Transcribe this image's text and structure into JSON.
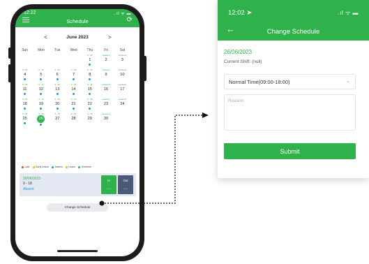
{
  "phone": {
    "status": {
      "time": "12:22",
      "signal": "..ıl ᯤ ▬"
    },
    "header": {
      "title": "Schedule"
    },
    "calendar": {
      "month": "June  2023",
      "prev": "<",
      "next": ">",
      "weekdays": [
        "Sun",
        "Mon",
        "Tue",
        "Wed",
        "Thu",
        "Fri",
        "Sat"
      ],
      "weeks": [
        [
          {
            "day": "",
            "mark": "",
            "dot": false
          },
          {
            "day": "",
            "mark": "",
            "dot": false
          },
          {
            "day": "",
            "mark": "",
            "dot": false
          },
          {
            "day": "",
            "mark": "",
            "dot": false
          },
          {
            "day": "1",
            "mark": "9 - 18",
            "dot": true
          },
          {
            "day": "2",
            "mark": "weekend",
            "dot": false
          },
          {
            "day": "3",
            "mark": "weekend",
            "dot": false
          }
        ],
        [
          {
            "day": "4",
            "mark": "9 - 18",
            "dot": true
          },
          {
            "day": "5",
            "mark": "9 - 18",
            "dot": true
          },
          {
            "day": "6",
            "mark": "9 - 18",
            "dot": true
          },
          {
            "day": "7",
            "mark": "9 - 18",
            "dot": true
          },
          {
            "day": "8",
            "mark": "9 - 18",
            "dot": true
          },
          {
            "day": "9",
            "mark": "weekend",
            "dot": false
          },
          {
            "day": "10",
            "mark": "weekend",
            "dot": false
          }
        ],
        [
          {
            "day": "11",
            "mark": "9 - 18",
            "dot": true
          },
          {
            "day": "12",
            "mark": "9 - 18",
            "dot": true
          },
          {
            "day": "13",
            "mark": "9 - 18",
            "dot": true
          },
          {
            "day": "14",
            "mark": "9 - 18",
            "dot": true
          },
          {
            "day": "15",
            "mark": "9 - 18",
            "dot": true
          },
          {
            "day": "16",
            "mark": "weekend",
            "dot": false
          },
          {
            "day": "17",
            "mark": "weekend",
            "dot": false
          }
        ],
        [
          {
            "day": "18",
            "mark": "9 - 18",
            "dot": true
          },
          {
            "day": "19",
            "mark": "9 - 18",
            "dot": true
          },
          {
            "day": "20",
            "mark": "9 - 18",
            "dot": true
          },
          {
            "day": "21",
            "mark": "9 - 18",
            "dot": true
          },
          {
            "day": "22",
            "mark": "9 - 18",
            "dot": true
          },
          {
            "day": "23",
            "mark": "weekend",
            "dot": false
          },
          {
            "day": "24",
            "mark": "weekend",
            "dot": false
          }
        ],
        [
          {
            "day": "25",
            "mark": "9 - 18",
            "dot": true
          },
          {
            "day": "26",
            "mark": "9 - 18",
            "dot": true,
            "selected": true
          },
          {
            "day": "27",
            "mark": "9 - 18",
            "dot": false
          },
          {
            "day": "28",
            "mark": "9 - 18",
            "dot": false
          },
          {
            "day": "29",
            "mark": "9 - 18",
            "dot": false
          },
          {
            "day": "30",
            "mark": "weekend",
            "dot": false
          },
          {
            "day": "",
            "mark": "",
            "dot": false
          }
        ]
      ]
    },
    "legend": [
      {
        "label": "Late",
        "color": "#e53935"
      },
      {
        "label": "Early Leave",
        "color": "#f4b400"
      },
      {
        "label": "Absent",
        "color": "#1a9ad6"
      },
      {
        "label": "Leave",
        "color": "#f4b400"
      },
      {
        "label": "Overtime",
        "color": "#2fb24c"
      }
    ],
    "attendance": {
      "date": "26/06/2023",
      "time": "9 - 18",
      "status": "Absent",
      "in_label": "In",
      "in_value": "--:--",
      "out_label": "Out",
      "out_value": "--:--"
    },
    "change_schedule_label": "Change Schedule"
  },
  "panel": {
    "status": {
      "time": "12:02 ➤",
      "signal": ".ıl ᯤ ▬"
    },
    "back": "←",
    "title": "Change Schedule",
    "date": "26/06/2023",
    "current_shift": "Current Shift: (null)",
    "shift_value": "Normal Time(09:00-18:00)",
    "chevron": "⌄",
    "reason_placeholder": "Reason",
    "submit_label": "Submit"
  },
  "colors": {
    "brand_green": "#2fb24c",
    "absent_blue": "#1a9ad6",
    "out_button": "#4b5a78"
  }
}
